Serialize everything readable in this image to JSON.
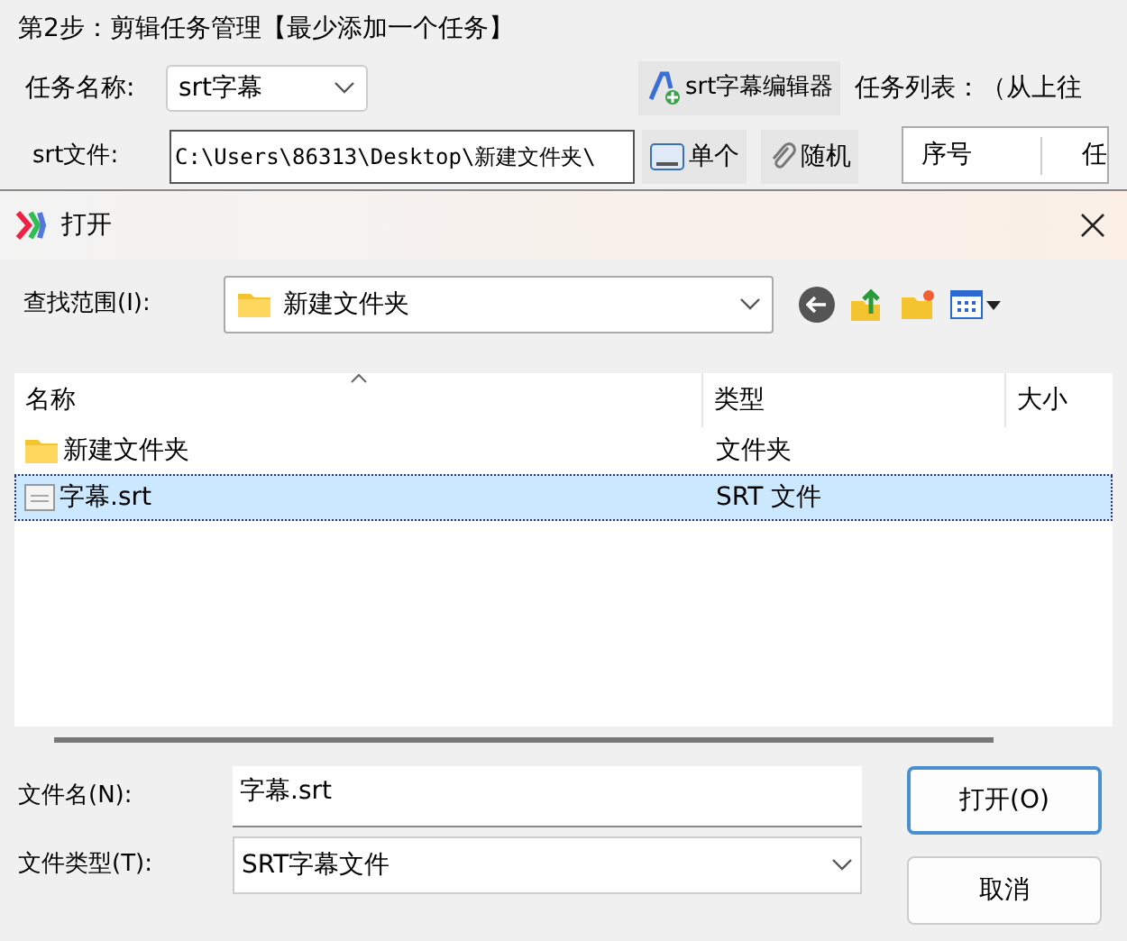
{
  "background": {
    "group_title": "第2步：剪辑任务管理【最少添加一个任务】",
    "task_name_label": "任务名称:",
    "task_name_value": "srt字幕",
    "editor_button": "srt字幕编辑器",
    "task_list_label": "任务列表：（从上往",
    "srt_label": "srt文件:",
    "srt_path": "C:\\Users\\86313\\Desktop\\新建文件夹\\",
    "single_button": "单个",
    "random_button": "随机",
    "task_columns": [
      "序号",
      "任"
    ]
  },
  "dialog": {
    "title": "打开",
    "look_in_label": "查找范围(I):",
    "look_in_value": "新建文件夹",
    "columns": [
      "名称",
      "类型",
      "大小"
    ],
    "files": [
      {
        "name": "新建文件夹",
        "type": "文件夹",
        "kind": "folder",
        "selected": false
      },
      {
        "name": "字幕.srt",
        "type": "SRT 文件",
        "kind": "srt",
        "selected": true
      }
    ],
    "file_name_label": "文件名(N):",
    "file_name_value": "字幕.srt",
    "file_type_label": "文件类型(T):",
    "file_type_value": "SRT字幕文件",
    "open_button": "打开(O)",
    "cancel_button": "取消"
  }
}
